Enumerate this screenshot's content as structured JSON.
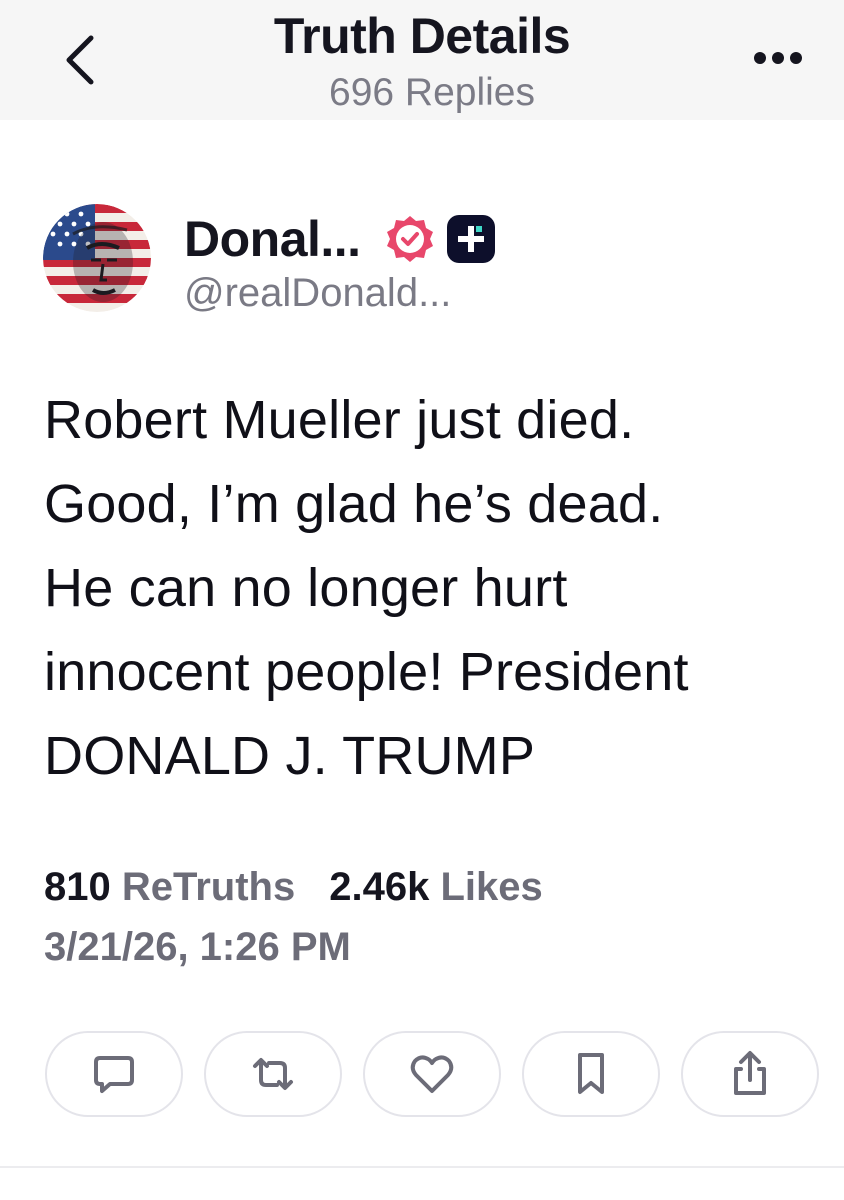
{
  "header": {
    "title": "Truth Details",
    "subtitle": "696 Replies",
    "back_icon": "chevron-left-icon",
    "more_icon": "more-horizontal-icon"
  },
  "author": {
    "name": "Donal...",
    "handle": "@realDonald...",
    "verified_icon": "verified-badge-icon",
    "verified_color": "#e8476b",
    "plus_icon": "plus-badge-icon"
  },
  "post": {
    "lines": [
      "Robert Mueller just died.",
      "Good, I’m glad he’s dead.",
      "He can no longer hurt",
      "innocent people! President",
      "DONALD J. TRUMP"
    ]
  },
  "stats": {
    "retruths_count": "810",
    "retruths_label": "ReTruths",
    "likes_count": "2.46k",
    "likes_label": "Likes",
    "timestamp": "3/21/26, 1:26 PM"
  },
  "actions": [
    {
      "name": "reply",
      "icon": "comment-icon"
    },
    {
      "name": "retruth",
      "icon": "repost-icon"
    },
    {
      "name": "like",
      "icon": "heart-icon"
    },
    {
      "name": "bookmark",
      "icon": "bookmark-icon"
    },
    {
      "name": "share",
      "icon": "share-icon"
    }
  ]
}
